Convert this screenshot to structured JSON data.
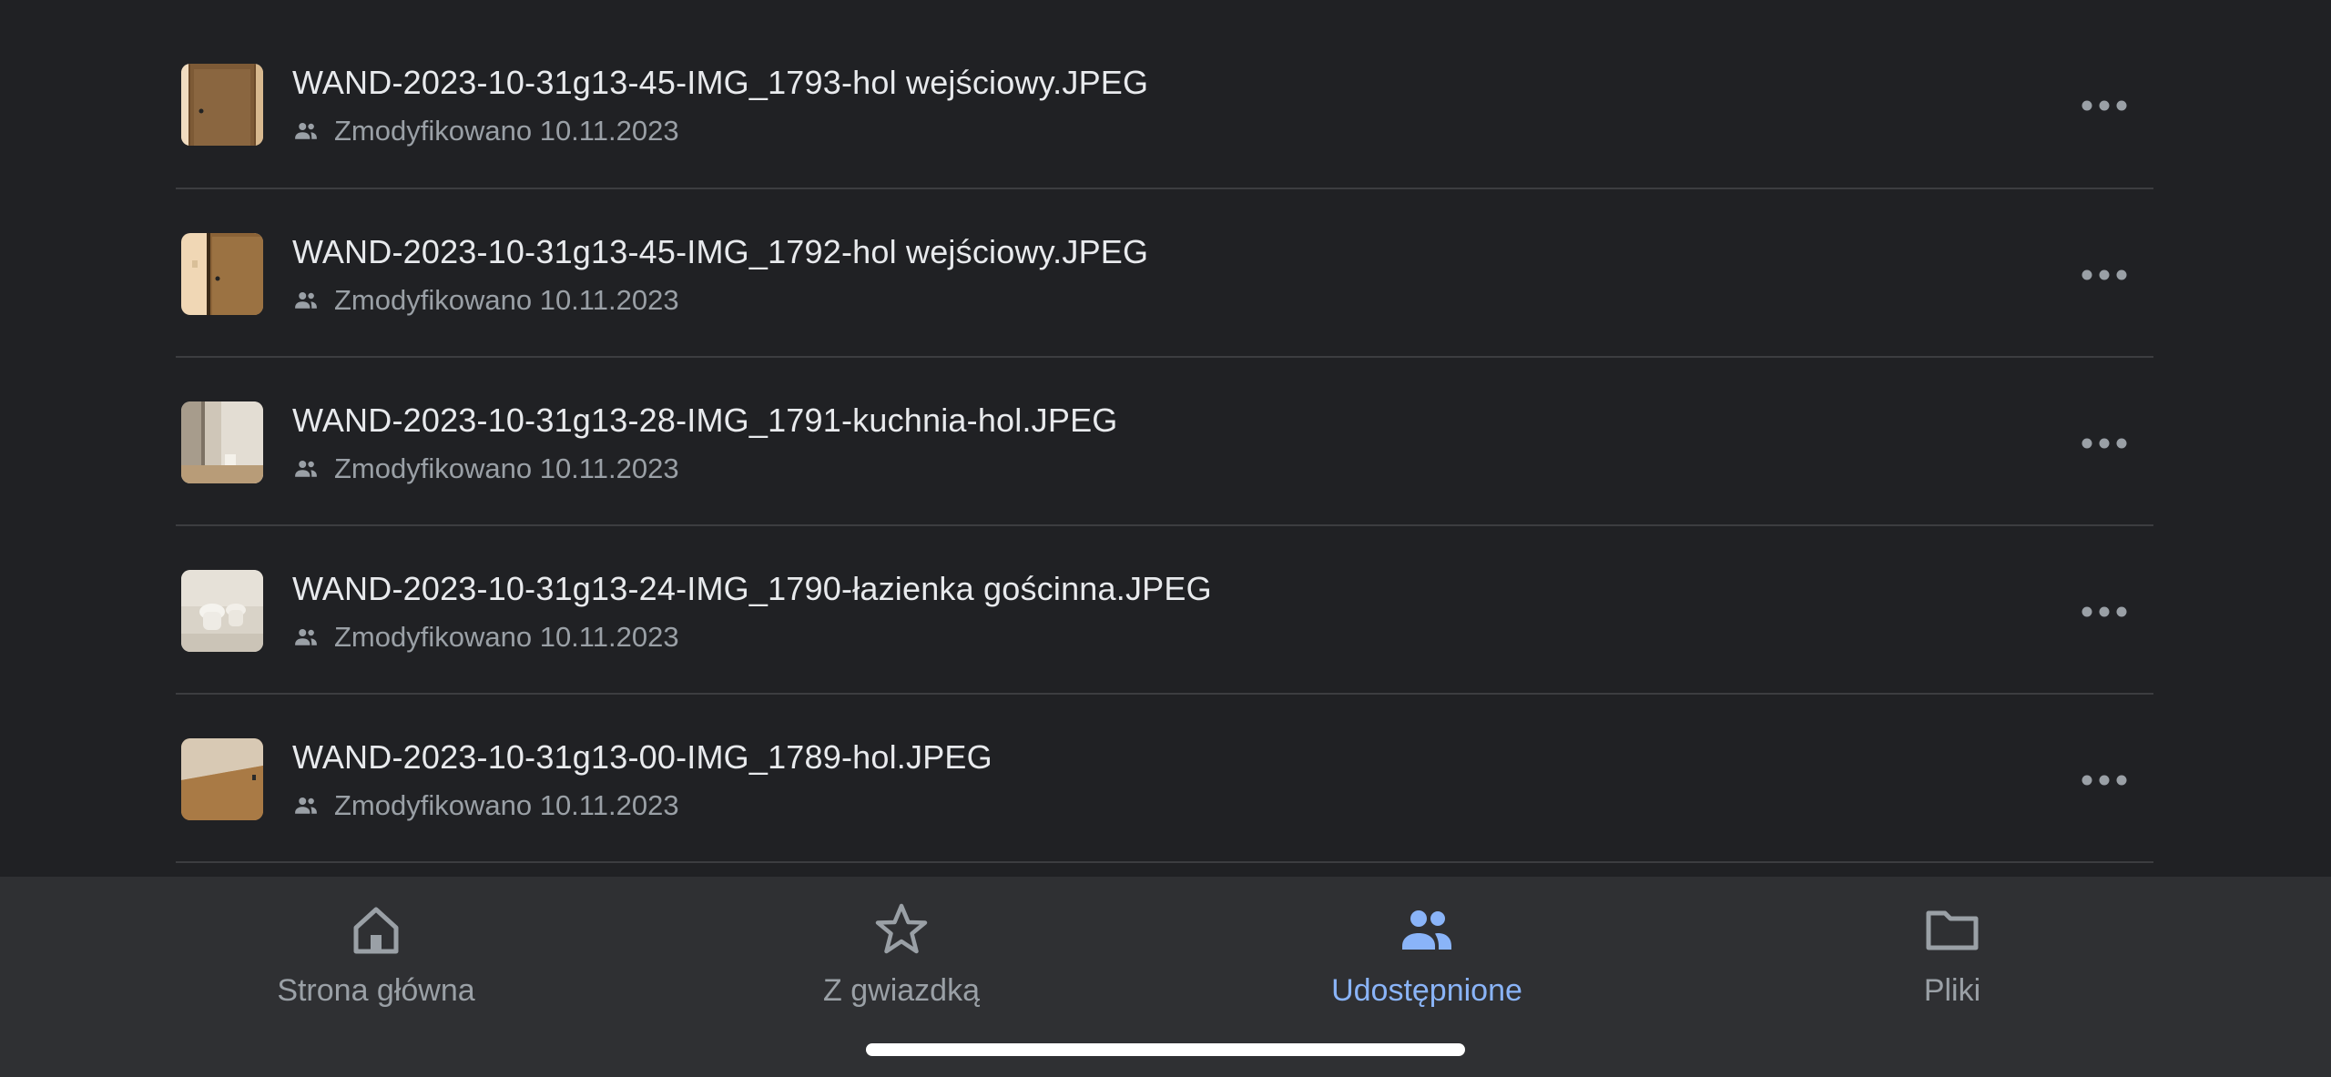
{
  "files": [
    {
      "name": "WAND-2023-10-31g13-45-IMG_1793-hol wejściowy.JPEG",
      "meta": "Zmodyfikowano 10.11.2023",
      "shared_icon": "people-icon",
      "more_icon": "more-horizontal-icon"
    },
    {
      "name": "WAND-2023-10-31g13-45-IMG_1792-hol wejściowy.JPEG",
      "meta": "Zmodyfikowano 10.11.2023",
      "shared_icon": "people-icon",
      "more_icon": "more-horizontal-icon"
    },
    {
      "name": "WAND-2023-10-31g13-28-IMG_1791-kuchnia-hol.JPEG",
      "meta": "Zmodyfikowano 10.11.2023",
      "shared_icon": "people-icon",
      "more_icon": "more-horizontal-icon"
    },
    {
      "name": "WAND-2023-10-31g13-24-IMG_1790-łazienka gościnna.JPEG",
      "meta": "Zmodyfikowano 10.11.2023",
      "shared_icon": "people-icon",
      "more_icon": "more-horizontal-icon"
    },
    {
      "name": "WAND-2023-10-31g13-00-IMG_1789-hol.JPEG",
      "meta": "Zmodyfikowano 10.11.2023",
      "shared_icon": "people-icon",
      "more_icon": "more-horizontal-icon"
    }
  ],
  "nav": {
    "items": [
      {
        "label": "Strona główna",
        "icon": "home-icon",
        "active": false
      },
      {
        "label": "Z gwiazdką",
        "icon": "star-icon",
        "active": false
      },
      {
        "label": "Udostępnione",
        "icon": "people-icon",
        "active": true
      },
      {
        "label": "Pliki",
        "icon": "folder-icon",
        "active": false
      }
    ]
  },
  "colors": {
    "background": "#202124",
    "nav_background": "#2f3033",
    "text_primary": "#e8eaed",
    "text_secondary": "#9aa0a6",
    "accent": "#8ab4f8",
    "divider": "#3c3d40"
  }
}
